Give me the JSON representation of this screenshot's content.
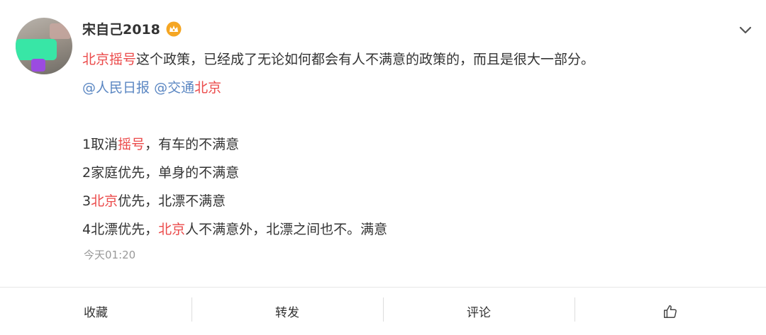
{
  "user": {
    "name": "宋自己2018",
    "badge_icon": "crown-icon",
    "badge_color": "#f5a623",
    "avatar_icon": "avatar"
  },
  "menu_icon": "chevron-down-icon",
  "post": {
    "line1": {
      "topic": "北京摇号",
      "text": "这个政策，已经成了无论如何都会有人不满意的政策的，而且是很大一部分。"
    },
    "mentions": {
      "m1": "@人民日报",
      "m2_prefix": "@交通",
      "m2_keyword": "北京"
    },
    "items": {
      "i1_a": "1取消",
      "i1_kw": "摇号",
      "i1_b": "，有车的不满意",
      "i2": "2家庭优先，单身的不满意",
      "i3_a": "3",
      "i3_kw": "北京",
      "i3_b": "优先，北漂不满意",
      "i4_a": "4北漂优先，",
      "i4_kw": "北京",
      "i4_b": "人不满意外，北漂之间也不。满意"
    },
    "timestamp": "今天01:20"
  },
  "actions": {
    "favorite": "收藏",
    "repost": "转发",
    "comment": "评论",
    "like_icon": "thumbs-up-icon"
  },
  "colors": {
    "keyword": "#eb4a4a",
    "mention": "#5a86c2",
    "text": "#333333",
    "muted": "#999999"
  }
}
